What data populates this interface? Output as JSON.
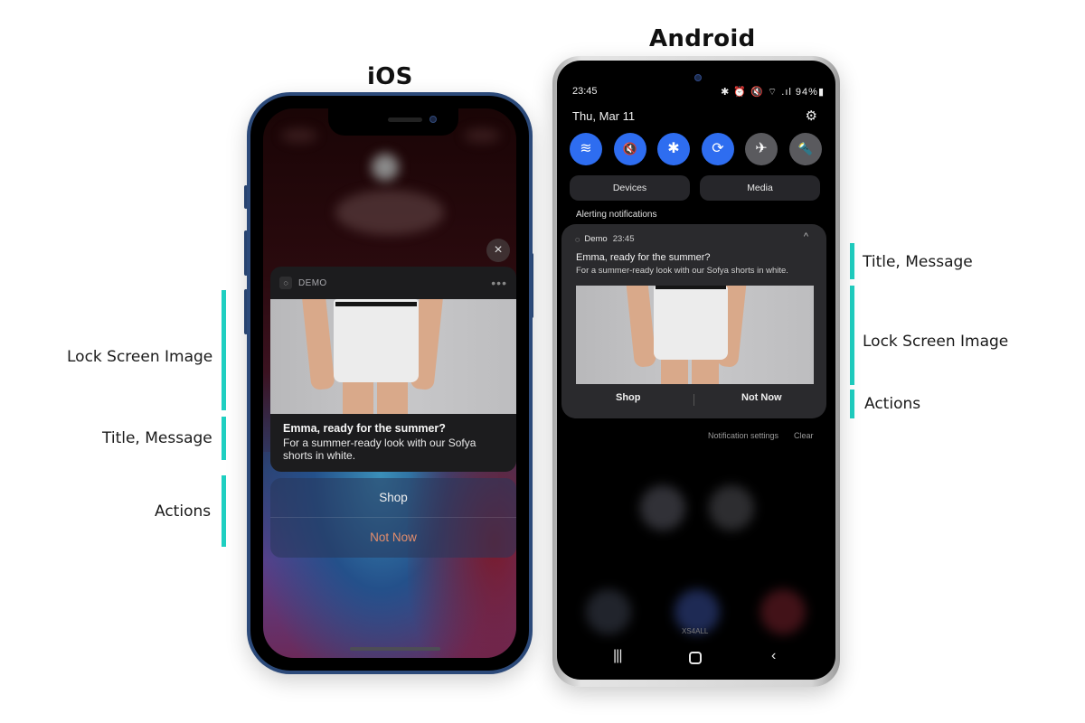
{
  "headings": {
    "ios": "iOS",
    "android": "Android"
  },
  "annotations": {
    "left": [
      {
        "label": "Lock Screen Image"
      },
      {
        "label": "Title, Message"
      },
      {
        "label": "Actions"
      }
    ],
    "right": [
      {
        "label": "Title, Message"
      },
      {
        "label": "Lock Screen Image"
      },
      {
        "label": "Actions"
      }
    ],
    "accent_color": "#1fcfc1"
  },
  "ios": {
    "close_icon": "×",
    "notification": {
      "app_icon": "chat-bubble-icon",
      "app_name": "DEMO",
      "more_icon": "•••",
      "image_alt": "Model wearing white shorts",
      "title": "Emma, ready for the summer?",
      "message": "For a summer-ready look with our Sofya shorts in white."
    },
    "actions": [
      {
        "label": "Shop",
        "color": "#f0f0f0"
      },
      {
        "label": "Not Now",
        "color": "#e28d6c"
      }
    ]
  },
  "android": {
    "status_bar": {
      "time": "23:45",
      "icons": "✱ ⏰ 🔇 ⌔ .ıl",
      "battery": "94%"
    },
    "date": "Thu, Mar 11",
    "settings_icon": "⚙",
    "quick_settings": [
      {
        "name": "wifi",
        "glyph": "≋",
        "on": true
      },
      {
        "name": "mute",
        "glyph": "🔇",
        "on": true
      },
      {
        "name": "bluetooth",
        "glyph": "✱",
        "on": true
      },
      {
        "name": "auto-rotate",
        "glyph": "⟳",
        "on": true
      },
      {
        "name": "airplane",
        "glyph": "✈",
        "on": false
      },
      {
        "name": "flashlight",
        "glyph": "🔦",
        "on": false
      }
    ],
    "pills": {
      "devices": "Devices",
      "media": "Media"
    },
    "section_label": "Alerting notifications",
    "notification": {
      "app_icon": "chat-bubble-icon",
      "app_name": "Demo",
      "time": "23:45",
      "collapse_icon": "^",
      "title": "Emma, ready for the summer?",
      "message": "For a summer-ready look with our Sofya shorts in white.",
      "image_alt": "Model wearing white shorts"
    },
    "actions": [
      {
        "label": "Shop"
      },
      {
        "label": "Not Now"
      }
    ],
    "footer": {
      "settings": "Notification settings",
      "clear": "Clear"
    },
    "dock_label": "XS4ALL",
    "nav": {
      "recent": "|||",
      "home": "",
      "back": "‹"
    }
  }
}
